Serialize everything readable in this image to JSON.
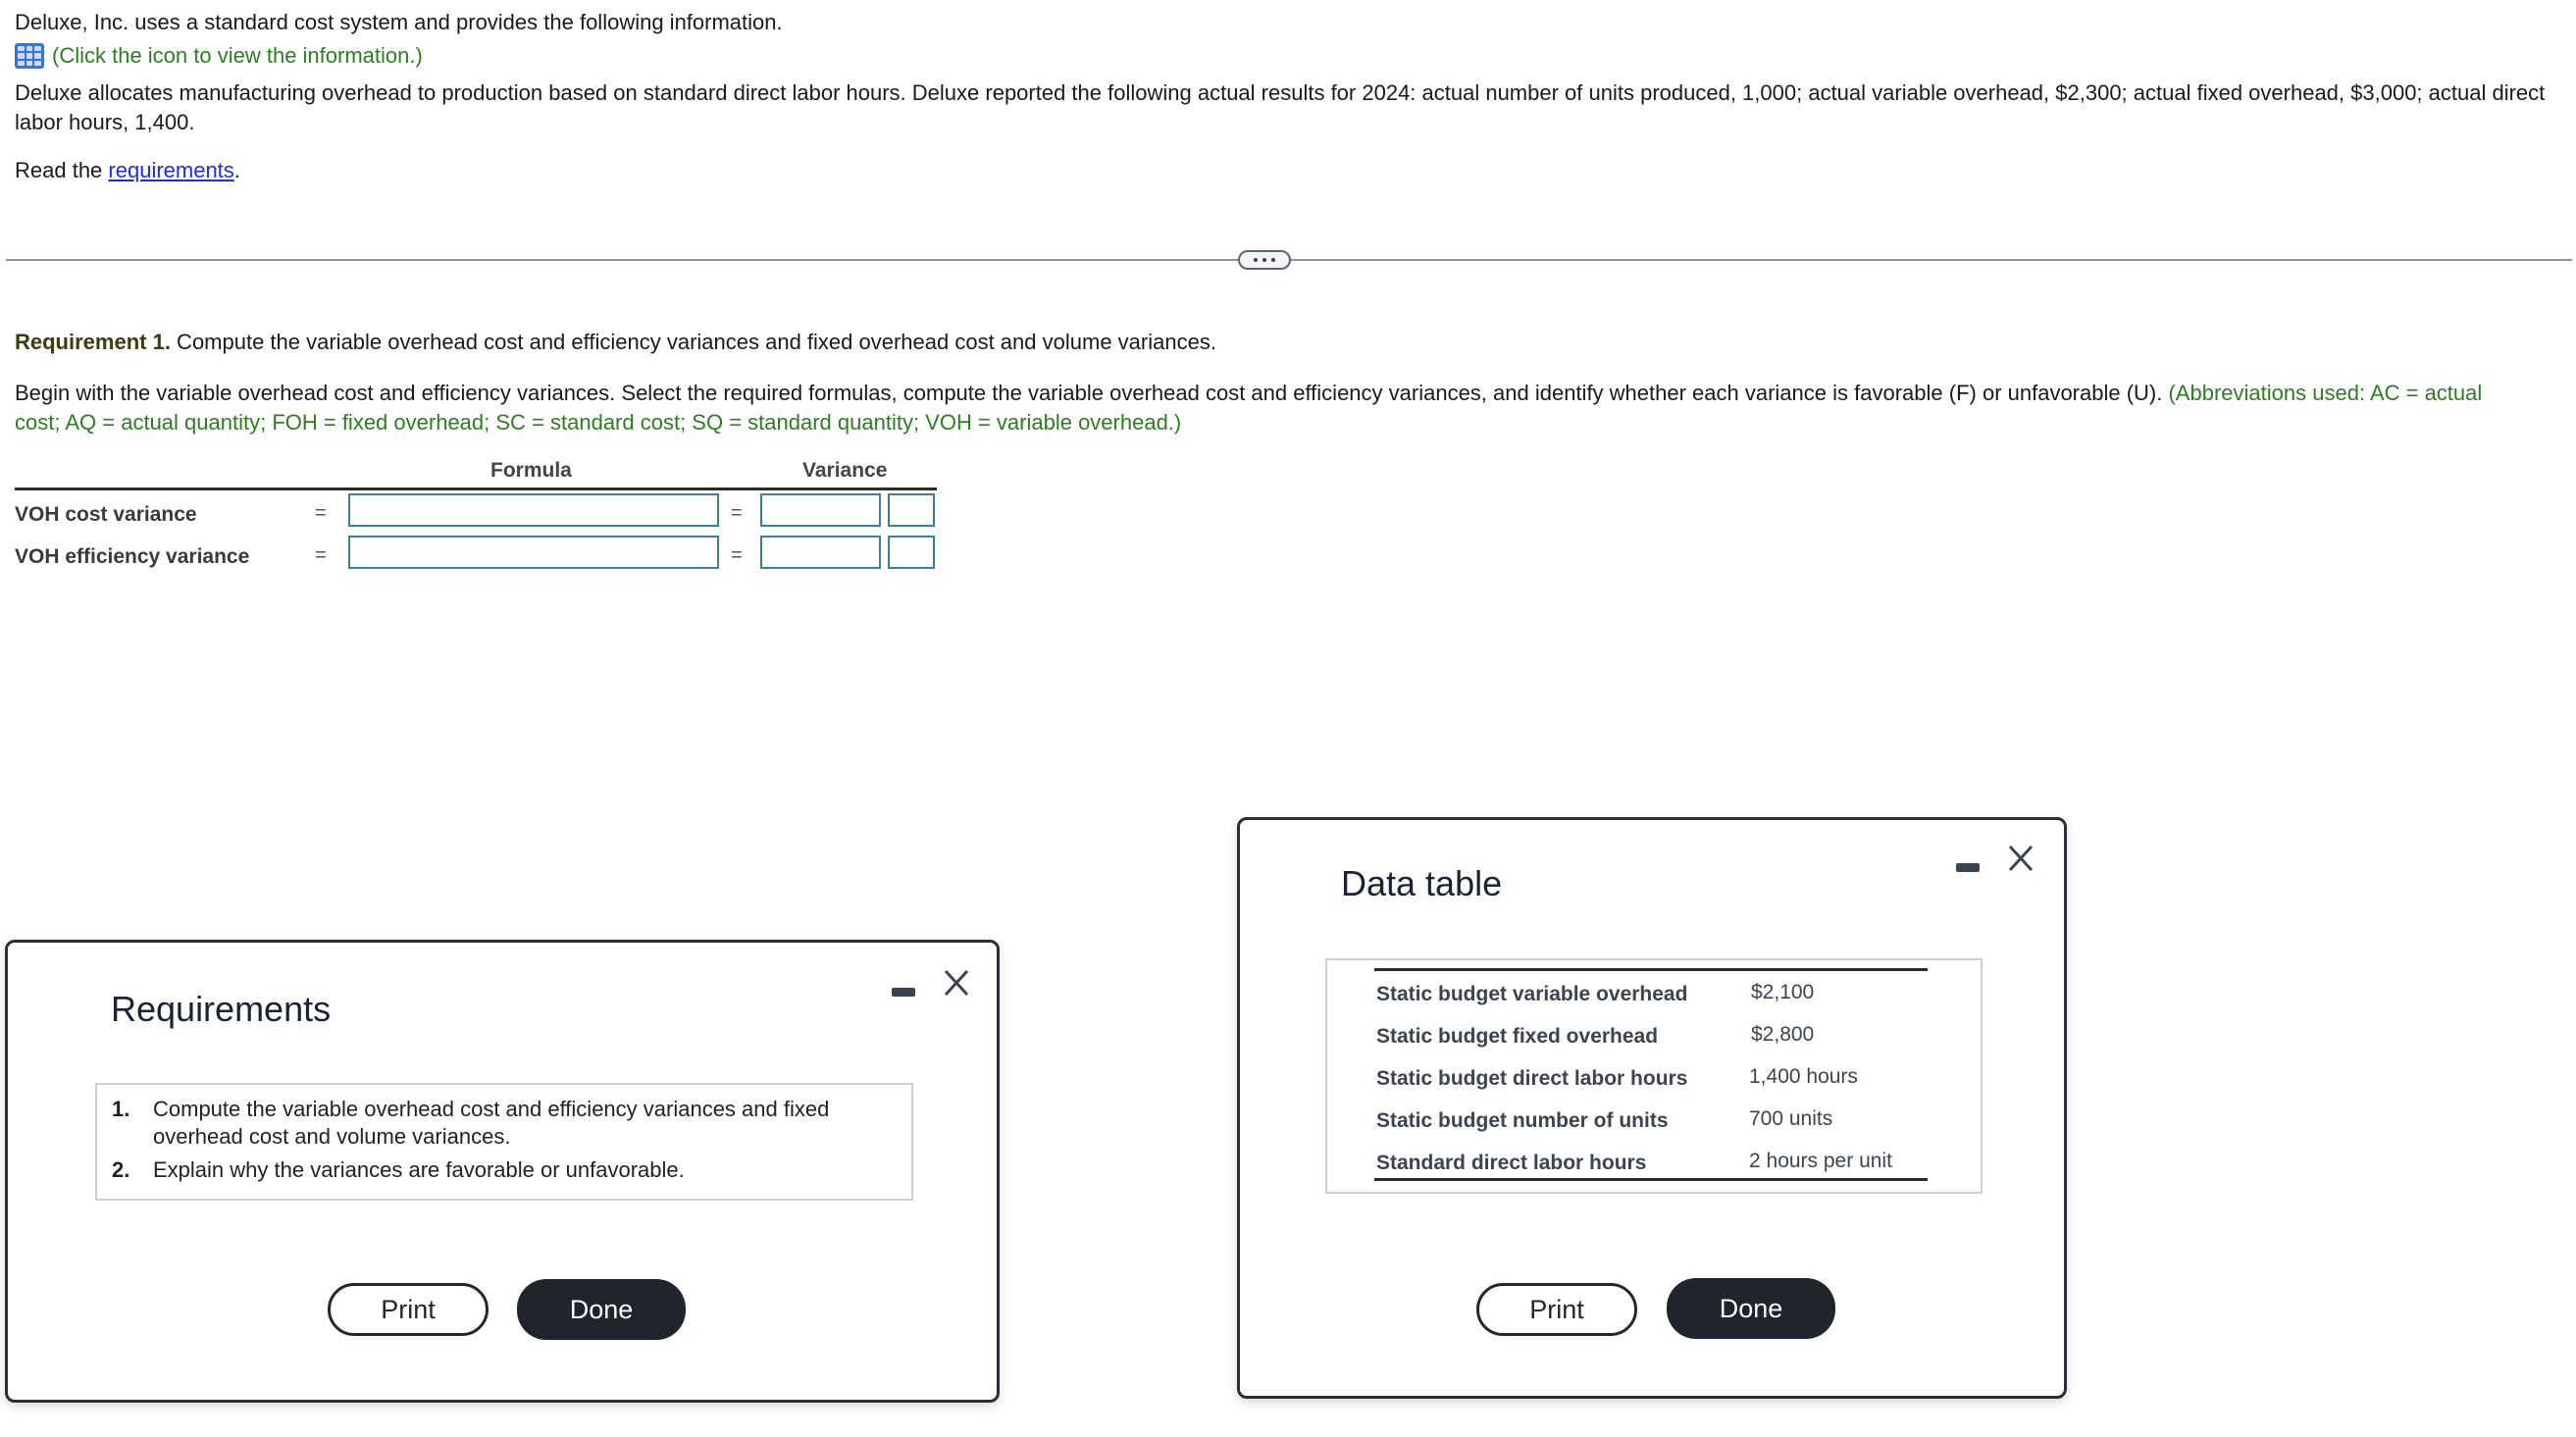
{
  "problem": {
    "intro": "Deluxe, Inc. uses a standard cost system and provides the following information.",
    "info_link": "(Click the icon to view the information.)",
    "info_icon": "table-grid-icon",
    "paragraph": "Deluxe allocates manufacturing overhead to production based on standard direct labor hours. Deluxe reported the following actual results for 2024: actual number of units produced, 1,000; actual variable overhead, $2,300; actual fixed overhead, $3,000; actual direct labor hours, 1,400.",
    "read_prefix": "Read the ",
    "read_link": "requirements",
    "read_suffix": "."
  },
  "divider": {
    "handle_icon": "more-horizontal-icon"
  },
  "requirement1": {
    "label": "Requirement 1.",
    "text": " Compute the variable overhead cost and efficiency variances and fixed overhead cost and volume variances.",
    "instructions": "Begin with the variable overhead cost and efficiency variances. Select the required formulas, compute the variable overhead cost and efficiency variances, and identify whether each variance is favorable (F) or unfavorable (U). ",
    "abbreviations": "(Abbreviations used: AC = actual cost; AQ = actual quantity; FOH = fixed overhead; SC = standard cost; SQ = standard quantity; VOH = variable overhead.)"
  },
  "variance_table": {
    "headers": {
      "formula": "Formula",
      "variance": "Variance"
    },
    "rows": [
      {
        "label": "VOH cost variance",
        "eq1": "=",
        "eq2": "=",
        "formula_value": "",
        "variance_value": "",
        "fu_value": ""
      },
      {
        "label": "VOH efficiency variance",
        "eq1": "=",
        "eq2": "=",
        "formula_value": "",
        "variance_value": "",
        "fu_value": ""
      }
    ]
  },
  "requirements_modal": {
    "title": "Requirements",
    "items": [
      {
        "num": "1.",
        "text": "Compute the variable overhead cost and efficiency variances and fixed overhead cost and volume variances."
      },
      {
        "num": "2.",
        "text": "Explain why the variances are favorable or unfavorable."
      }
    ],
    "print_label": "Print",
    "done_label": "Done"
  },
  "data_modal": {
    "title": "Data table",
    "rows": [
      {
        "label": "Static budget variable overhead",
        "value": "$2,100"
      },
      {
        "label": "Static budget fixed overhead",
        "value": "$2,800"
      },
      {
        "label": "Static budget direct labor hours",
        "value": "1,400 hours"
      },
      {
        "label": "Static budget number of units",
        "value": "700 units"
      },
      {
        "label": "Standard direct labor hours",
        "value": "2 hours per unit"
      }
    ],
    "print_label": "Print",
    "done_label": "Done"
  }
}
